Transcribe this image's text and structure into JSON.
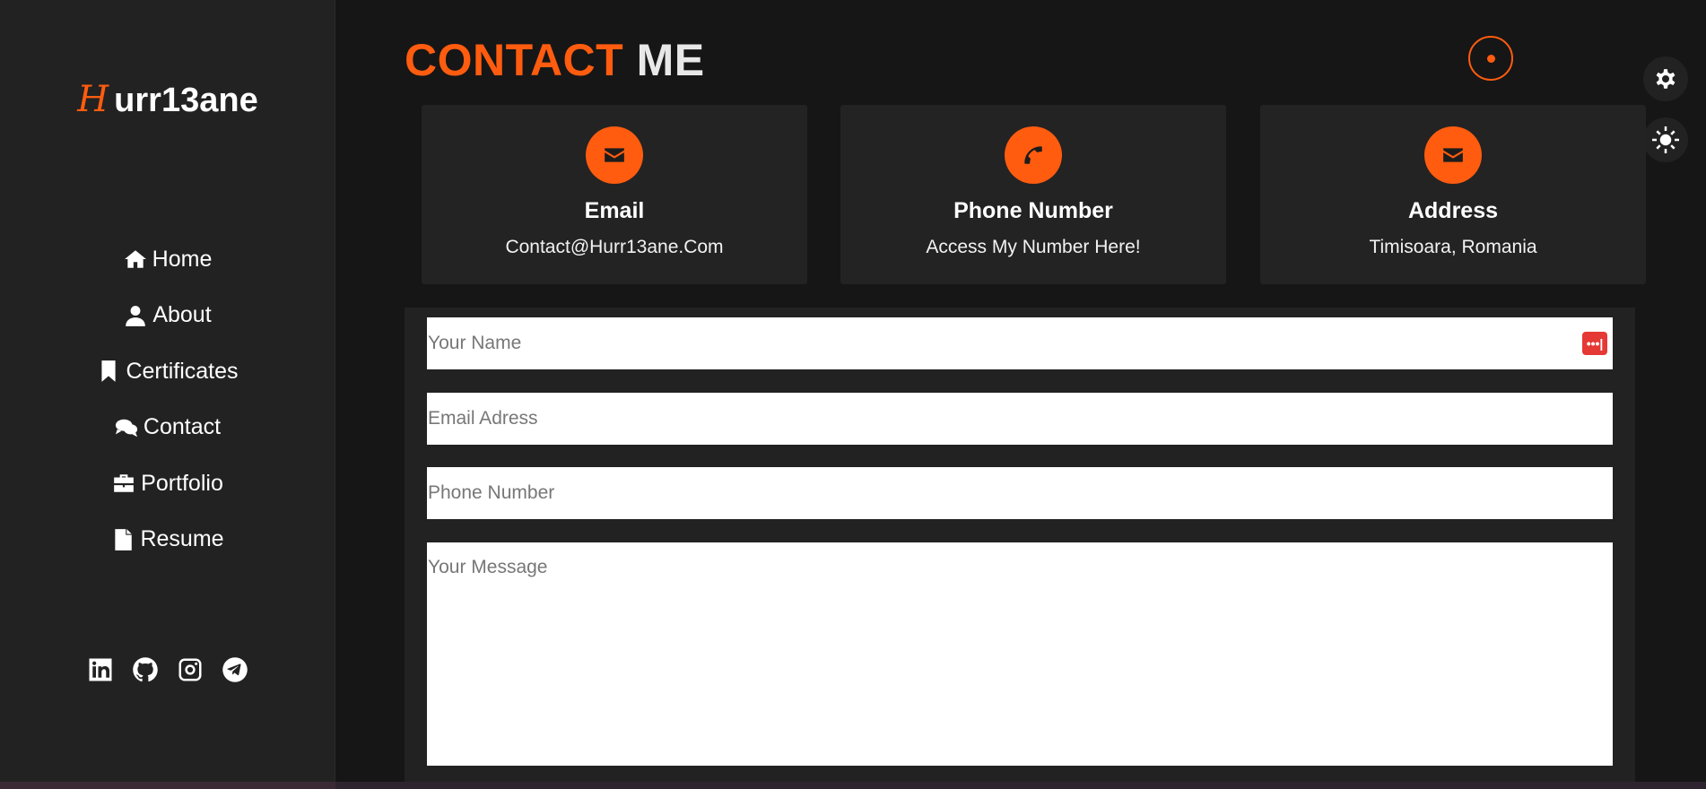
{
  "sidebar": {
    "logo_mark": "H",
    "logo_text": "urr13ane",
    "items": [
      {
        "label": "Home",
        "icon": "home-icon"
      },
      {
        "label": "About",
        "icon": "user-icon"
      },
      {
        "label": "Certificates",
        "icon": "bookmark-icon"
      },
      {
        "label": "Contact",
        "icon": "comments-icon"
      },
      {
        "label": "Portfolio",
        "icon": "briefcase-icon"
      },
      {
        "label": "Resume",
        "icon": "file-icon"
      }
    ],
    "socials": [
      "linkedin-icon",
      "github-icon",
      "instagram-icon",
      "telegram-icon"
    ]
  },
  "header": {
    "title_part1": "CONTACT",
    "title_part2": "ME"
  },
  "cards": [
    {
      "title": "Email",
      "text": "Contact@Hurr13ane.Com",
      "icon": "envelope-icon"
    },
    {
      "title": "Phone Number",
      "text": "Access My Number Here!",
      "icon": "phone-icon"
    },
    {
      "title": "Address",
      "text": "Timisoara, Romania",
      "icon": "envelope-icon"
    }
  ],
  "form": {
    "name_placeholder": "Your Name",
    "email_placeholder": "Email Adress",
    "phone_placeholder": "Phone Number",
    "message_placeholder": "Your Message",
    "name_value": "",
    "email_value": "",
    "phone_value": "",
    "message_value": ""
  },
  "password_manager_badge": "•••|",
  "colors": {
    "accent": "#ff5c0f",
    "background": "#161616",
    "panel": "#222222"
  }
}
